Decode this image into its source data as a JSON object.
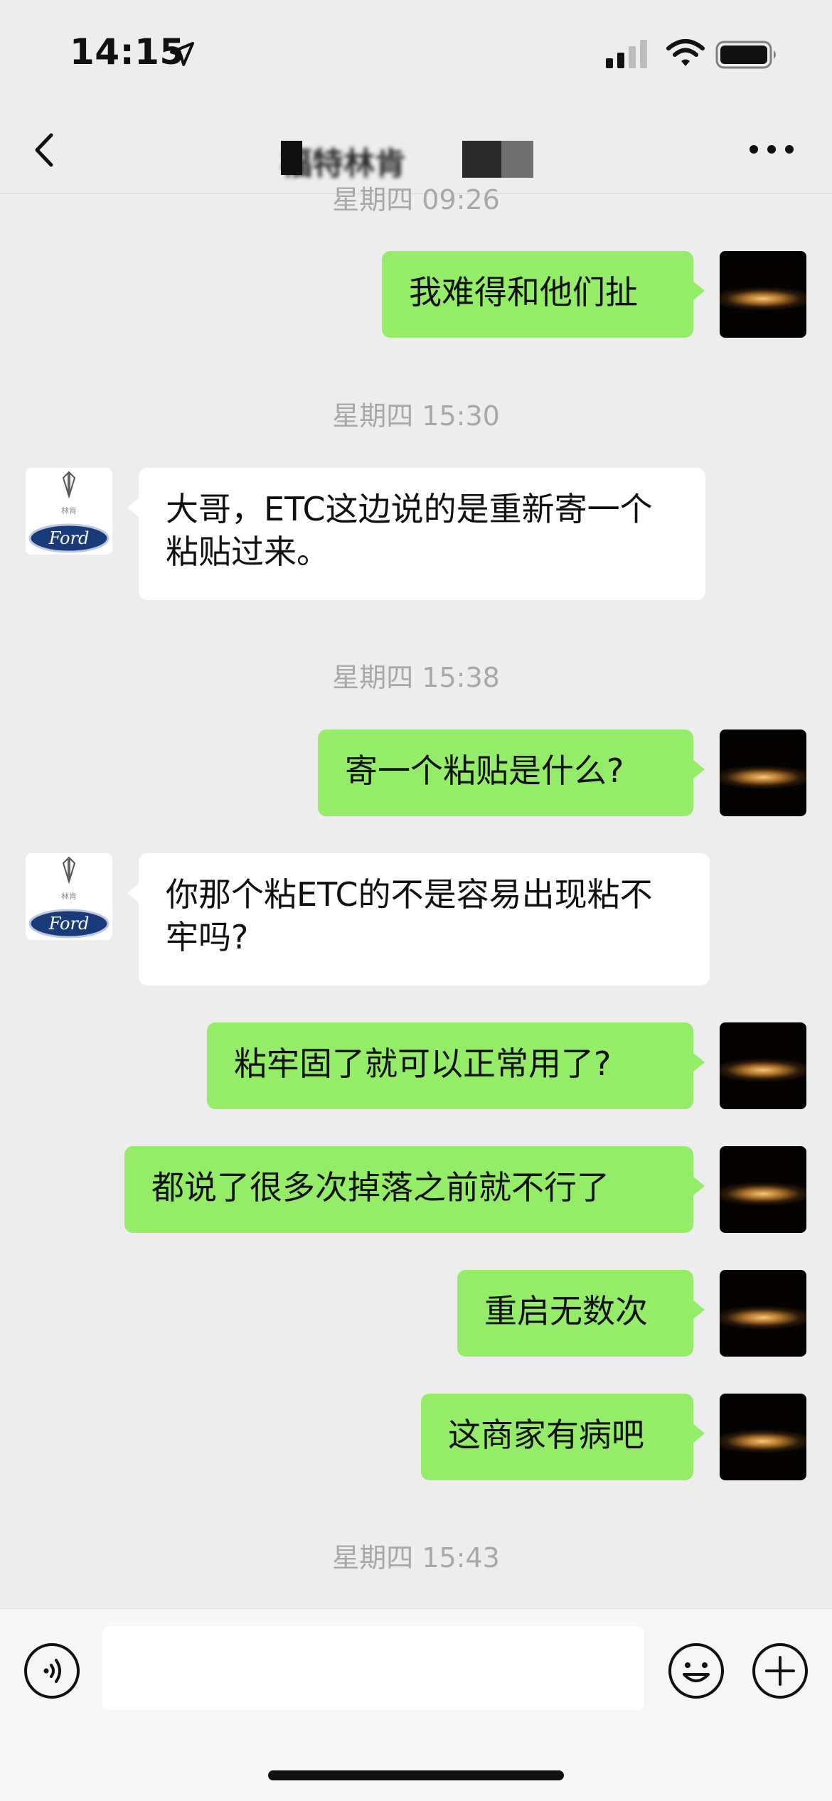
{
  "status": {
    "time": "14:15",
    "icons": [
      "location-arrow-icon",
      "cellular-signal-icon",
      "wifi-icon",
      "battery-icon"
    ]
  },
  "header": {
    "title": "福特林肯",
    "back_icon": "chevron-left-icon",
    "more_icon": "more-dots-icon"
  },
  "chat": {
    "timestamps": [
      "星期四 09:26",
      "星期四 15:30",
      "星期四 15:38",
      "星期四 15:43"
    ],
    "messages": [
      {
        "sender": "me",
        "text": "我难得和他们扯"
      },
      {
        "sender": "other",
        "text": "大哥，ETC这边说的是重新寄一个粘贴过来。"
      },
      {
        "sender": "me",
        "text": "寄一个粘贴是什么?"
      },
      {
        "sender": "other",
        "text": "你那个粘ETC的不是容易出现粘不牢吗?"
      },
      {
        "sender": "me",
        "text": "粘牢固了就可以正常用了?"
      },
      {
        "sender": "me",
        "text": "都说了很多次掉落之前就不行了"
      },
      {
        "sender": "me",
        "text": "重启无数次"
      },
      {
        "sender": "me",
        "text": "这商家有病吧"
      }
    ],
    "other_avatar": {
      "logo_text": "Ford",
      "subtext": "林肯"
    }
  },
  "input": {
    "value": "",
    "placeholder": "",
    "icons": [
      "voice-icon",
      "emoji-icon",
      "plus-icon"
    ]
  },
  "colors": {
    "background": "#ededed",
    "my_bubble": "#95ec69",
    "other_bubble": "#ffffff",
    "timestamp": "#a8a8a8"
  }
}
